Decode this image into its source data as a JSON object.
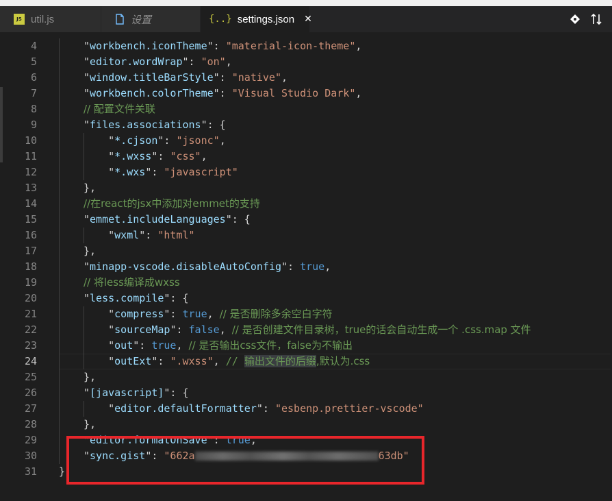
{
  "window": {
    "top_strip_color": "#f0f0f0"
  },
  "tabs": [
    {
      "label": "util.js",
      "icon": "js-file-icon",
      "icon_text": "JS",
      "active": false
    },
    {
      "label": "设置",
      "icon": "settings-file-icon",
      "active": false
    },
    {
      "label": "settings.json",
      "icon": "json-file-icon",
      "icon_text": "{..}",
      "active": true
    }
  ],
  "actions": [
    {
      "name": "git-compare-icon",
      "glyph": "◈"
    },
    {
      "name": "open-changes-icon",
      "glyph": "⇅"
    }
  ],
  "editor": {
    "current_line": "24",
    "lines": [
      {
        "n": "4",
        "t": [
          {
            "c": "p",
            "v": "\""
          },
          {
            "c": "k",
            "v": "workbench.iconTheme"
          },
          {
            "c": "p",
            "v": "\": "
          },
          {
            "c": "s",
            "v": "\"material-icon-theme\""
          },
          {
            "c": "p",
            "v": ","
          }
        ]
      },
      {
        "n": "5",
        "t": [
          {
            "c": "p",
            "v": "\""
          },
          {
            "c": "k",
            "v": "editor.wordWrap"
          },
          {
            "c": "p",
            "v": "\": "
          },
          {
            "c": "s",
            "v": "\"on\""
          },
          {
            "c": "p",
            "v": ","
          }
        ]
      },
      {
        "n": "6",
        "t": [
          {
            "c": "p",
            "v": "\""
          },
          {
            "c": "k",
            "v": "window.titleBarStyle"
          },
          {
            "c": "p",
            "v": "\": "
          },
          {
            "c": "s",
            "v": "\"native\""
          },
          {
            "c": "p",
            "v": ","
          }
        ]
      },
      {
        "n": "7",
        "t": [
          {
            "c": "p",
            "v": "\""
          },
          {
            "c": "k",
            "v": "workbench.colorTheme"
          },
          {
            "c": "p",
            "v": "\": "
          },
          {
            "c": "s",
            "v": "\"Visual Studio Dark\""
          },
          {
            "c": "p",
            "v": ","
          }
        ]
      },
      {
        "n": "8",
        "t": [
          {
            "c": "c",
            "v": "// 配置文件关联"
          }
        ]
      },
      {
        "n": "9",
        "t": [
          {
            "c": "p",
            "v": "\""
          },
          {
            "c": "k",
            "v": "files.associations"
          },
          {
            "c": "p",
            "v": "\": {"
          }
        ]
      },
      {
        "n": "10",
        "t": [
          {
            "c": "p",
            "v": "    \""
          },
          {
            "c": "k",
            "v": "*.cjson"
          },
          {
            "c": "p",
            "v": "\": "
          },
          {
            "c": "s",
            "v": "\"jsonc\""
          },
          {
            "c": "p",
            "v": ","
          }
        ]
      },
      {
        "n": "11",
        "t": [
          {
            "c": "p",
            "v": "    \""
          },
          {
            "c": "k",
            "v": "*.wxss"
          },
          {
            "c": "p",
            "v": "\": "
          },
          {
            "c": "s",
            "v": "\"css\""
          },
          {
            "c": "p",
            "v": ","
          }
        ]
      },
      {
        "n": "12",
        "t": [
          {
            "c": "p",
            "v": "    \""
          },
          {
            "c": "k",
            "v": "*.wxs"
          },
          {
            "c": "p",
            "v": "\": "
          },
          {
            "c": "s",
            "v": "\"javascript\""
          }
        ]
      },
      {
        "n": "13",
        "t": [
          {
            "c": "p",
            "v": "},"
          }
        ]
      },
      {
        "n": "14",
        "t": [
          {
            "c": "c",
            "v": "//在react的jsx中添加对emmet的支持"
          }
        ]
      },
      {
        "n": "15",
        "t": [
          {
            "c": "p",
            "v": "\""
          },
          {
            "c": "k",
            "v": "emmet.includeLanguages"
          },
          {
            "c": "p",
            "v": "\": {"
          }
        ]
      },
      {
        "n": "16",
        "t": [
          {
            "c": "p",
            "v": "    \""
          },
          {
            "c": "k",
            "v": "wxml"
          },
          {
            "c": "p",
            "v": "\": "
          },
          {
            "c": "s",
            "v": "\"html\""
          }
        ]
      },
      {
        "n": "17",
        "t": [
          {
            "c": "p",
            "v": "},"
          }
        ]
      },
      {
        "n": "18",
        "t": [
          {
            "c": "p",
            "v": "\""
          },
          {
            "c": "k",
            "v": "minapp-vscode.disableAutoConfig"
          },
          {
            "c": "p",
            "v": "\": "
          },
          {
            "c": "b",
            "v": "true"
          },
          {
            "c": "p",
            "v": ","
          }
        ]
      },
      {
        "n": "19",
        "t": [
          {
            "c": "c",
            "v": "// 将less编译成wxss"
          }
        ]
      },
      {
        "n": "20",
        "t": [
          {
            "c": "p",
            "v": "\""
          },
          {
            "c": "k",
            "v": "less.compile"
          },
          {
            "c": "p",
            "v": "\": {"
          }
        ]
      },
      {
        "n": "21",
        "t": [
          {
            "c": "p",
            "v": "    \""
          },
          {
            "c": "k",
            "v": "compress"
          },
          {
            "c": "p",
            "v": "\": "
          },
          {
            "c": "b",
            "v": "true"
          },
          {
            "c": "p",
            "v": ", "
          },
          {
            "c": "c",
            "v": "// 是否删除多余空白字符"
          }
        ]
      },
      {
        "n": "22",
        "t": [
          {
            "c": "p",
            "v": "    \""
          },
          {
            "c": "k",
            "v": "sourceMap"
          },
          {
            "c": "p",
            "v": "\": "
          },
          {
            "c": "b",
            "v": "false"
          },
          {
            "c": "p",
            "v": ", "
          },
          {
            "c": "c",
            "v": "// 是否创建文件目录树，true的话会自动生成一个 .css.map 文件"
          }
        ]
      },
      {
        "n": "23",
        "t": [
          {
            "c": "p",
            "v": "    \""
          },
          {
            "c": "k",
            "v": "out"
          },
          {
            "c": "p",
            "v": "\": "
          },
          {
            "c": "b",
            "v": "true"
          },
          {
            "c": "p",
            "v": ", "
          },
          {
            "c": "c",
            "v": "// 是否输出css文件，false为不输出"
          }
        ]
      },
      {
        "n": "24",
        "t": [
          {
            "c": "p",
            "v": "    \""
          },
          {
            "c": "k",
            "v": "outExt"
          },
          {
            "c": "p",
            "v": "\": "
          },
          {
            "c": "s",
            "v": "\".wxss\""
          },
          {
            "c": "p",
            "v": ", "
          },
          {
            "c": "c",
            "v": "// "
          },
          {
            "c": "c hl",
            "v": "输出文件的后缀"
          },
          {
            "c": "c",
            "v": ",默认为.css"
          }
        ]
      },
      {
        "n": "25",
        "t": [
          {
            "c": "p",
            "v": "},"
          }
        ]
      },
      {
        "n": "26",
        "t": [
          {
            "c": "p",
            "v": "\""
          },
          {
            "c": "k",
            "v": "[javascript]"
          },
          {
            "c": "p",
            "v": "\": {"
          }
        ]
      },
      {
        "n": "27",
        "t": [
          {
            "c": "p",
            "v": "    \""
          },
          {
            "c": "k",
            "v": "editor.defaultFormatter"
          },
          {
            "c": "p",
            "v": "\": "
          },
          {
            "c": "s",
            "v": "\"esbenp.prettier-vscode\""
          }
        ]
      },
      {
        "n": "28",
        "t": [
          {
            "c": "p",
            "v": "},"
          }
        ]
      },
      {
        "n": "29",
        "t": [
          {
            "c": "p",
            "v": "\""
          },
          {
            "c": "k",
            "v": "editor.formatOnSave"
          },
          {
            "c": "p",
            "v": "\": "
          },
          {
            "c": "b",
            "v": "true"
          },
          {
            "c": "p",
            "v": ","
          }
        ]
      },
      {
        "n": "30",
        "t": [
          {
            "c": "p",
            "v": "\""
          },
          {
            "c": "k",
            "v": "sync.gist"
          },
          {
            "c": "p",
            "v": "\": "
          },
          {
            "c": "s",
            "v": "\"662a"
          },
          {
            "c": "blur",
            "v": ""
          },
          {
            "c": "s",
            "v": "63db\""
          }
        ]
      },
      {
        "n": "31",
        "t": [
          {
            "c": "p",
            "v": "}"
          }
        ]
      }
    ]
  },
  "annotation": {
    "color": "#e8262b"
  }
}
